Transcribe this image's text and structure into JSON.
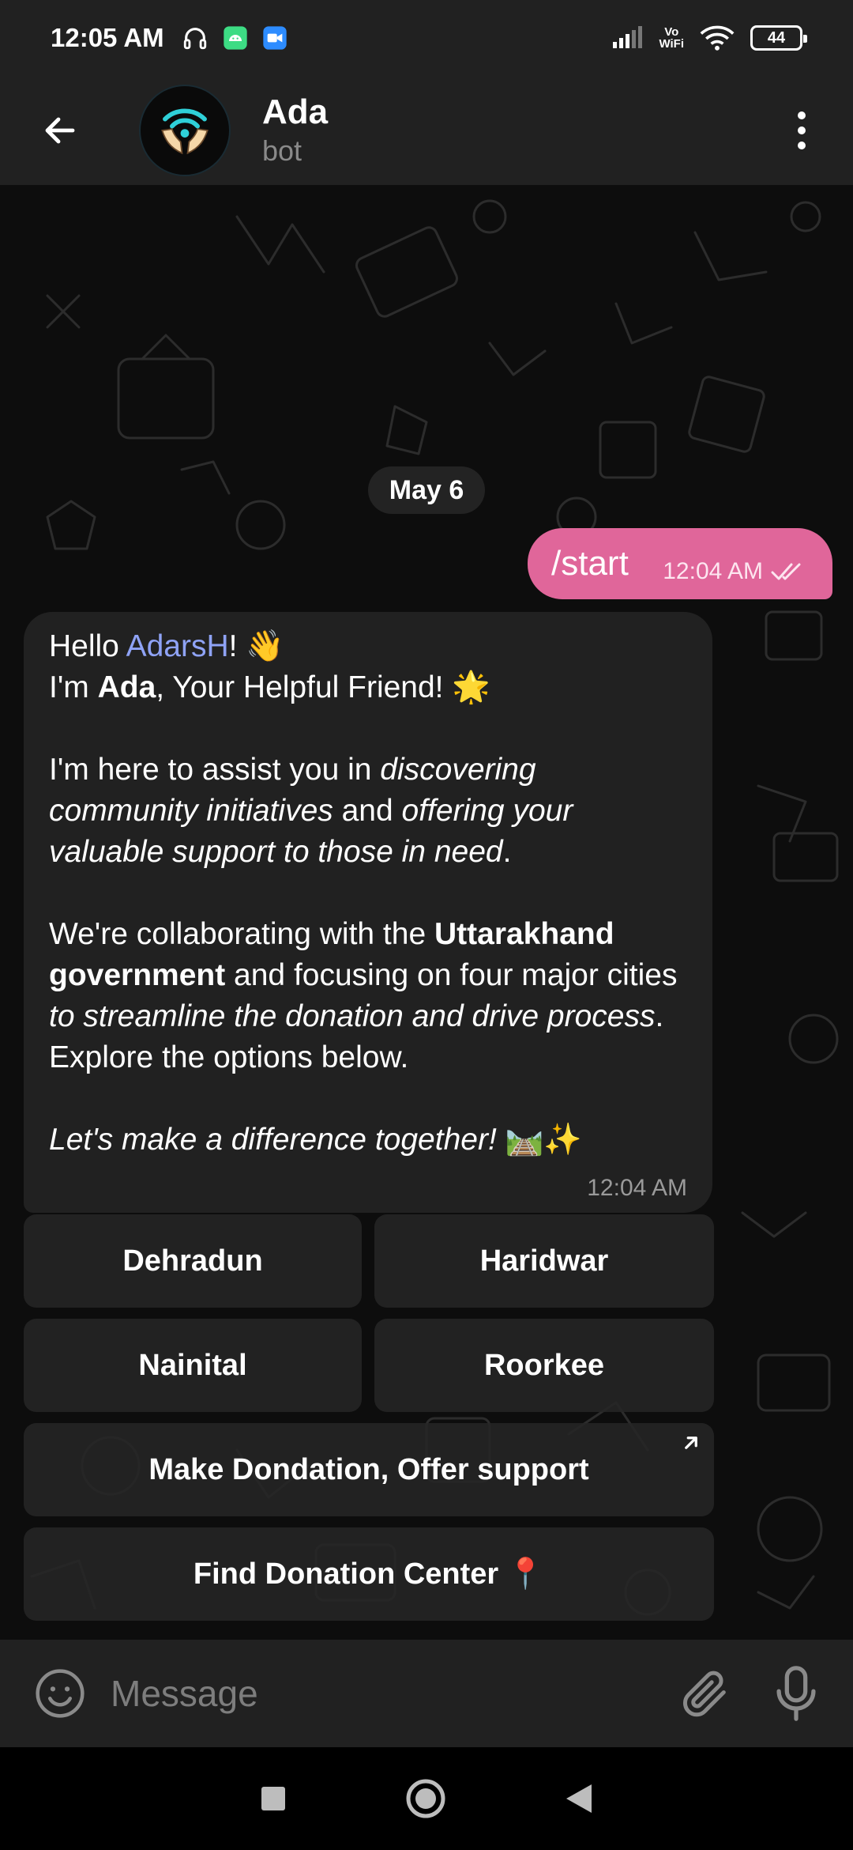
{
  "status_bar": {
    "time": "12:05 AM",
    "vowifi_top": "Vo",
    "vowifi_bottom": "WiFi",
    "battery": "44"
  },
  "header": {
    "title": "Ada",
    "subtitle": "bot"
  },
  "chat": {
    "date_separator": "May 6",
    "outgoing": {
      "text": "/start",
      "time": "12:04 AM"
    },
    "incoming": {
      "time": "12:04 AM",
      "line1_a": "Hello ",
      "mention": "AdarsH",
      "line1_b": "! 👋",
      "line2_a": "I'm ",
      "line2_bold": "Ada",
      "line2_b": ", Your Helpful Friend! 🌟",
      "p2_a": "I'm here to assist you in ",
      "p2_i1": "discovering community initiatives",
      "p2_b": " and ",
      "p2_i2": "offering your valuable support to those in need",
      "p2_c": ".",
      "p3_a": "We're collaborating with the ",
      "p3_bold": "Uttarakhand government",
      "p3_b": " and focusing on four major cities ",
      "p3_i": "to streamline the donation and drive process",
      "p3_c": ". Explore the options below.",
      "p4_i": "Let's make a difference together!",
      "p4_emoji": " 🛤️✨"
    }
  },
  "keyboard": {
    "dehradun": "Dehradun",
    "haridwar": "Haridwar",
    "nainital": "Nainital",
    "roorkee": "Roorkee",
    "make_donation": "Make Dondation, Offer support",
    "find_center": "Find Donation Center 📍"
  },
  "input": {
    "placeholder": "Message"
  },
  "colors": {
    "accent_outgoing": "#e0669a",
    "mention": "#8fa3f6",
    "bubble_incoming": "#212121",
    "bar": "#212121"
  }
}
